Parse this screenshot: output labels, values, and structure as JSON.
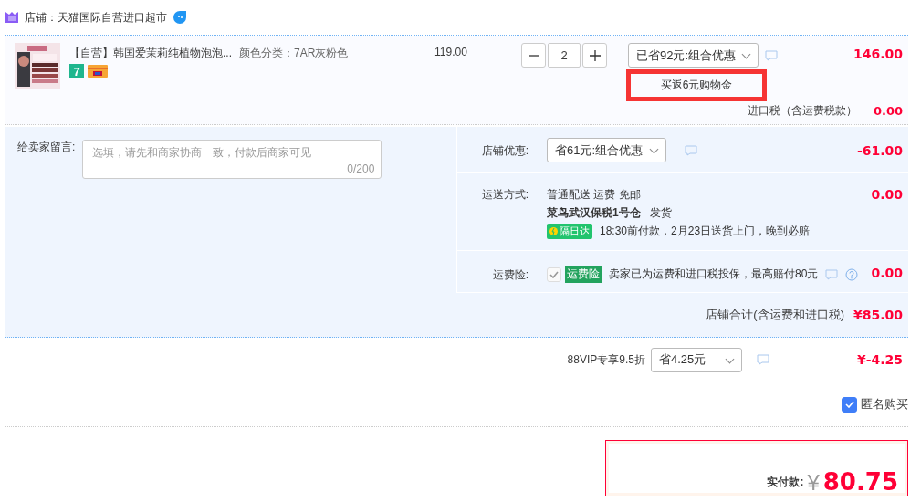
{
  "shop": {
    "label": "店铺：天猫国际自营进口超市"
  },
  "item": {
    "title": "【自营】韩国爱茉莉纯植物泡泡...",
    "spec": "颜色分类：7AR灰粉色",
    "badge": "7",
    "price": "119.00",
    "quantity": "2",
    "promo": "已省92元:组合优惠",
    "rebate": "买返6元购物金",
    "subtotal": "146.00",
    "tax_label": "进口税（含运费税款）",
    "tax": "0.00"
  },
  "message": {
    "label": "给卖家留言:",
    "placeholder": "选填，请先和商家协商一致，付款后商家可见",
    "counter": "0/200"
  },
  "rows": [
    {
      "kind": "select",
      "label": "店铺优惠:",
      "value": "省61元:组合优惠",
      "amount": "-61.00"
    },
    {
      "kind": "shipping",
      "label": "运送方式:",
      "method": "普通配送 运费 免邮",
      "warehouse": "菜鸟武汉保税1号仓",
      "dispatch": "发货",
      "tag": "隔日达",
      "promise": "18:30前付款，2月23日送货上门，晚到必赔",
      "amount": "0.00"
    },
    {
      "kind": "insurance",
      "label": "运费险:",
      "checked": true,
      "disabled": true,
      "tag": "运费险",
      "text": "卖家已为运费和进口税投保，最高赔付80元",
      "amount": "0.00"
    }
  ],
  "store_total": {
    "label": "店铺合计(含运费和进口税)",
    "amount": "¥85.00"
  },
  "vip": {
    "label": "88VIP专享9.5折",
    "value": "省4.25元",
    "amount": "¥-4.25"
  },
  "anonymous": {
    "label": "匿名购买",
    "checked": true
  },
  "payment": {
    "label": "实付款:",
    "currency": "¥",
    "amount": "80.75"
  }
}
